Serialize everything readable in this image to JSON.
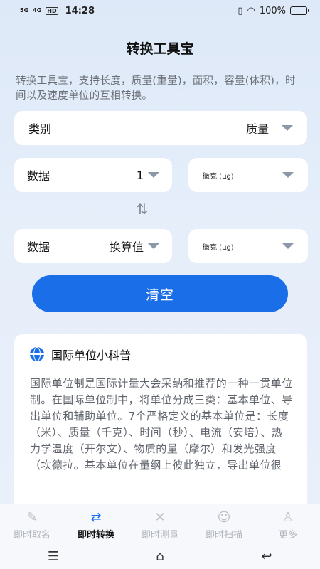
{
  "status": {
    "net1": "5G",
    "net2": "4G",
    "hd": "HD",
    "time": "14:28",
    "battery": "100%"
  },
  "page": {
    "title": "转换工具宝",
    "description": "转换工具宝，支持长度，质量(重量)，面积，容量(体积)，时间以及速度单位的互相转换。"
  },
  "category": {
    "label": "类别",
    "value": "质量"
  },
  "input": {
    "label": "数据",
    "value": "1",
    "unit": "微克 (μg)"
  },
  "output": {
    "label": "数据",
    "value": "换算值",
    "unit": "微克 (μg)"
  },
  "swap_icon": "⇅",
  "clear_button": "清空",
  "info": {
    "title": "国际单位小科普",
    "body": "国际单位制是国际计量大会采纳和推荐的一种一贯单位制。在国际单位制中，将单位分成三类：基本单位、导出单位和辅助单位。7个严格定义的基本单位是：长度（米）、质量（千克）、时间（秒）、电流（安培）、热力学温度（开尔文）、物质的量（摩尔）和发光强度（坎德拉。基本单位在量纲上彼此独立，导出单位很"
  },
  "tabs": [
    {
      "label": "即时取名",
      "icon": "pencil-icon"
    },
    {
      "label": "即时转换",
      "icon": "convert-icon"
    },
    {
      "label": "即时测量",
      "icon": "ruler-icon"
    },
    {
      "label": "即时扫描",
      "icon": "scan-icon"
    },
    {
      "label": "更多",
      "icon": "user-icon"
    }
  ],
  "accent_color": "#1a6ee8"
}
